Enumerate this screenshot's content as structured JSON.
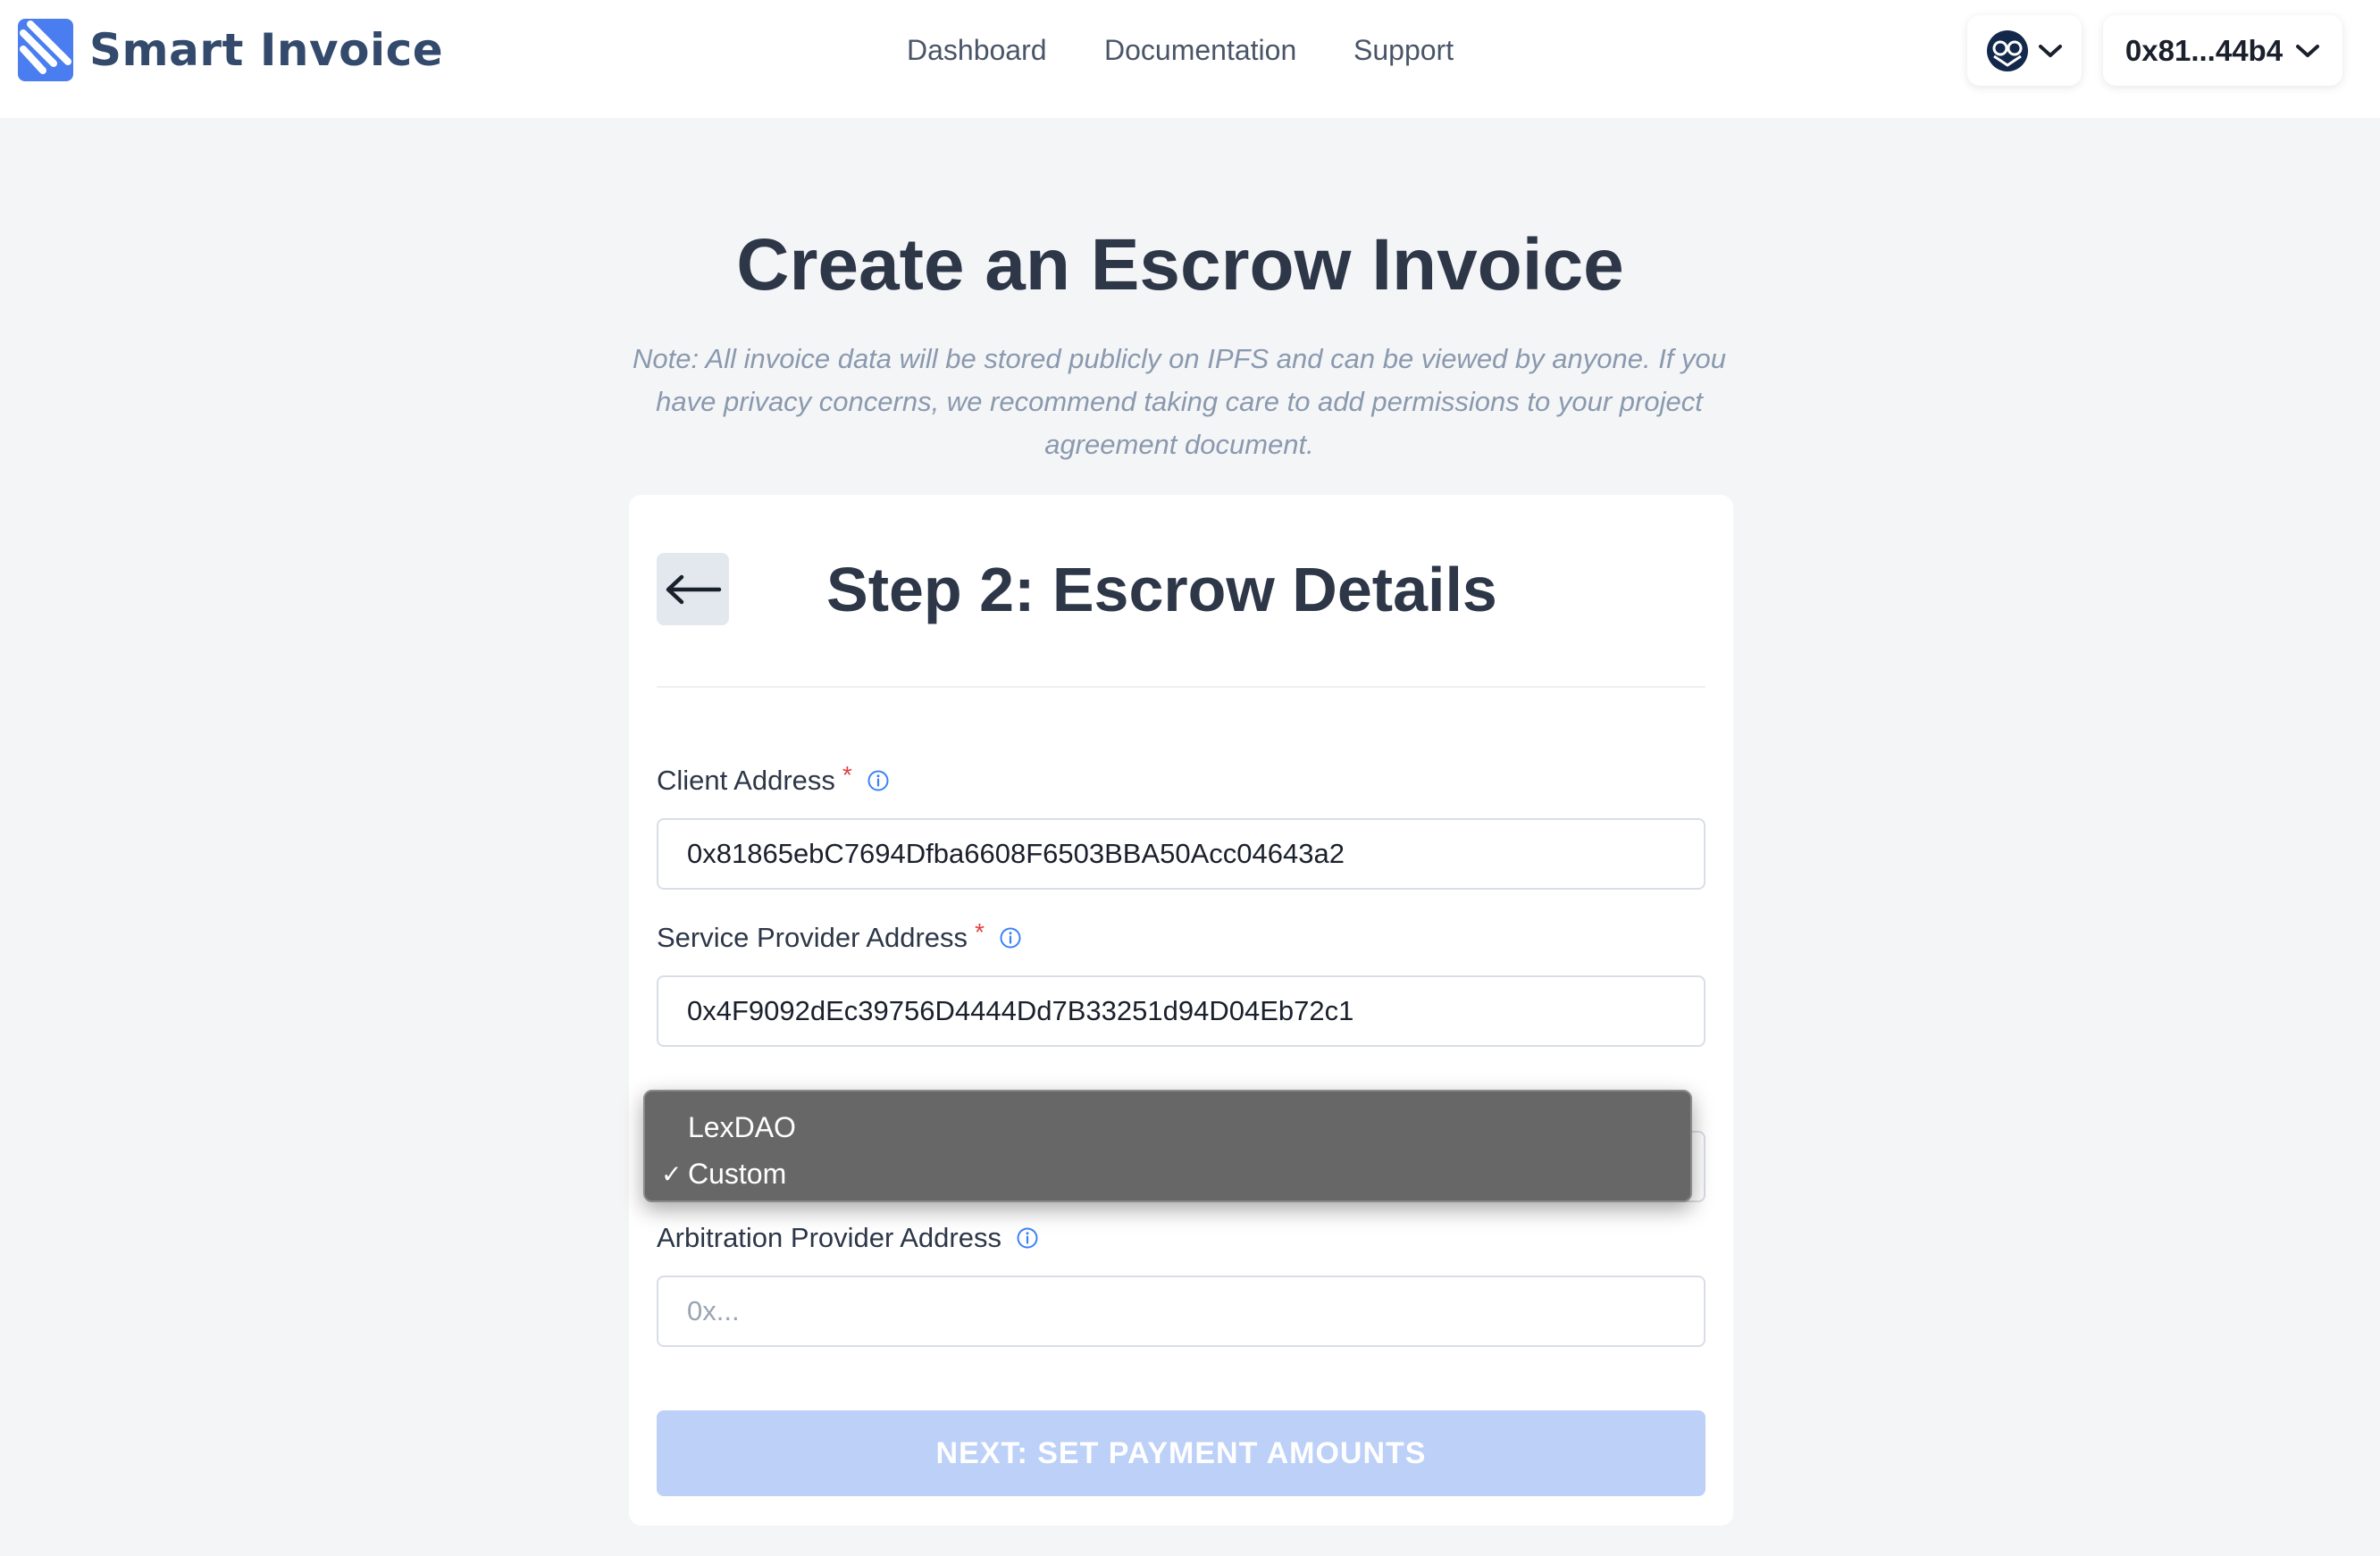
{
  "app": {
    "brand": "Smart Invoice"
  },
  "nav": {
    "items": [
      "Dashboard",
      "Documentation",
      "Support"
    ]
  },
  "header": {
    "network_icon": "gnosis-owl-icon",
    "account": "0x81...44b4"
  },
  "page": {
    "title": "Create an Escrow Invoice",
    "note": "Note: All invoice data will be stored publicly on IPFS and can be viewed by anyone. If you have privacy concerns, we recommend taking care to add permissions to your project agreement document."
  },
  "form": {
    "step_title": "Step 2: Escrow Details",
    "client_address": {
      "label": "Client Address",
      "required_mark": "*",
      "value": "0x81865ebC7694Dfba6608F6503BBA50Acc04643a2"
    },
    "provider_address": {
      "label": "Service Provider Address",
      "required_mark": "*",
      "value": "0x4F9092dEc39756D4444Dd7B33251d94D04Eb72c1"
    },
    "arbitration_provider": {
      "selected": "Custom",
      "options": [
        "LexDAO",
        "Custom"
      ],
      "check_mark": "✓"
    },
    "arbitration_address": {
      "label": "Arbitration Provider Address",
      "value": "",
      "placeholder": "0x..."
    },
    "next_button": "NEXT: SET PAYMENT AMOUNTS"
  },
  "colors": {
    "primary": "#3b82f6",
    "next_button_disabled": "#bcd0f8",
    "required": "#e53e3e",
    "info_icon": "#3b82f6"
  }
}
